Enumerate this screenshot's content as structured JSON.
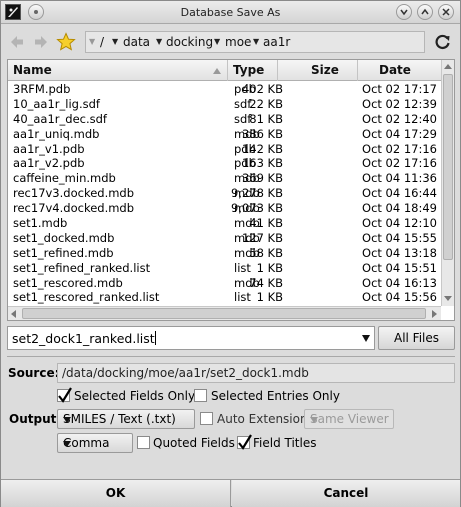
{
  "window": {
    "title": "Database Save As"
  },
  "path": {
    "root": "/",
    "crumbs": [
      "data",
      "docking",
      "moe",
      "aa1r"
    ]
  },
  "file_list": {
    "columns": {
      "name": "Name",
      "type": "Type",
      "size": "Size",
      "date": "Date"
    },
    "rows": [
      {
        "name": "3RFM.pdb",
        "type": "pdb",
        "size": "402 KB",
        "date": "Oct 02 17:17"
      },
      {
        "name": "10_aa1r_lig.sdf",
        "type": "sdf",
        "size": "22 KB",
        "date": "Oct 02 12:39"
      },
      {
        "name": "40_aa1r_dec.sdf",
        "type": "sdf",
        "size": "81 KB",
        "date": "Oct 02 12:40"
      },
      {
        "name": "aa1r_uniq.mdb",
        "type": "mdb",
        "size": "386 KB",
        "date": "Oct 04 17:29"
      },
      {
        "name": "aa1r_v1.pdb",
        "type": "pdb",
        "size": "142 KB",
        "date": "Oct 02 17:16"
      },
      {
        "name": "aa1r_v2.pdb",
        "type": "pdb",
        "size": "163 KB",
        "date": "Oct 02 17:16"
      },
      {
        "name": "caffeine_min.mdb",
        "type": "mdb",
        "size": "369 KB",
        "date": "Oct 04 11:36"
      },
      {
        "name": "rec17v3.docked.mdb",
        "type": "mdb",
        "size": "9,278 KB",
        "date": "Oct 04 16:44"
      },
      {
        "name": "rec17v4.docked.mdb",
        "type": "mdb",
        "size": "9,073 KB",
        "date": "Oct 04 18:49"
      },
      {
        "name": "set1.mdb",
        "type": "mdb",
        "size": "41 KB",
        "date": "Oct 04 12:10"
      },
      {
        "name": "set1_docked.mdb",
        "type": "mdb",
        "size": "127 KB",
        "date": "Oct 04 15:55"
      },
      {
        "name": "set1_refined.mdb",
        "type": "mdb",
        "size": "58 KB",
        "date": "Oct 04 13:18"
      },
      {
        "name": "set1_refined_ranked.list",
        "type": "list",
        "size": "1 KB",
        "date": "Oct 04 15:51"
      },
      {
        "name": "set1_rescored.mdb",
        "type": "mdb",
        "size": "74 KB",
        "date": "Oct 04 16:13"
      },
      {
        "name": "set1_rescored_ranked.list",
        "type": "list",
        "size": "1 KB",
        "date": "Oct 04 15:56"
      }
    ]
  },
  "filename": {
    "value": "set2_dock1_ranked.list",
    "filter_button": "All Files"
  },
  "source": {
    "label": "Source:",
    "value": "/data/docking/moe/aa1r/set2_dock1.mdb"
  },
  "options": {
    "selected_fields_only": {
      "label": "Selected Fields Only",
      "checked": true
    },
    "selected_entries_only": {
      "label": "Selected Entries Only",
      "checked": false
    },
    "output_label": "Output:",
    "output_format": "SMILES / Text (.txt)",
    "auto_extension": {
      "label": "Auto Extension",
      "checked": false
    },
    "viewer": "Same Viewer",
    "separator": "Comma",
    "quoted_fields": {
      "label": "Quoted Fields",
      "checked": false
    },
    "field_titles": {
      "label": "Field Titles",
      "checked": true
    }
  },
  "buttons": {
    "ok": "OK",
    "cancel": "Cancel"
  }
}
